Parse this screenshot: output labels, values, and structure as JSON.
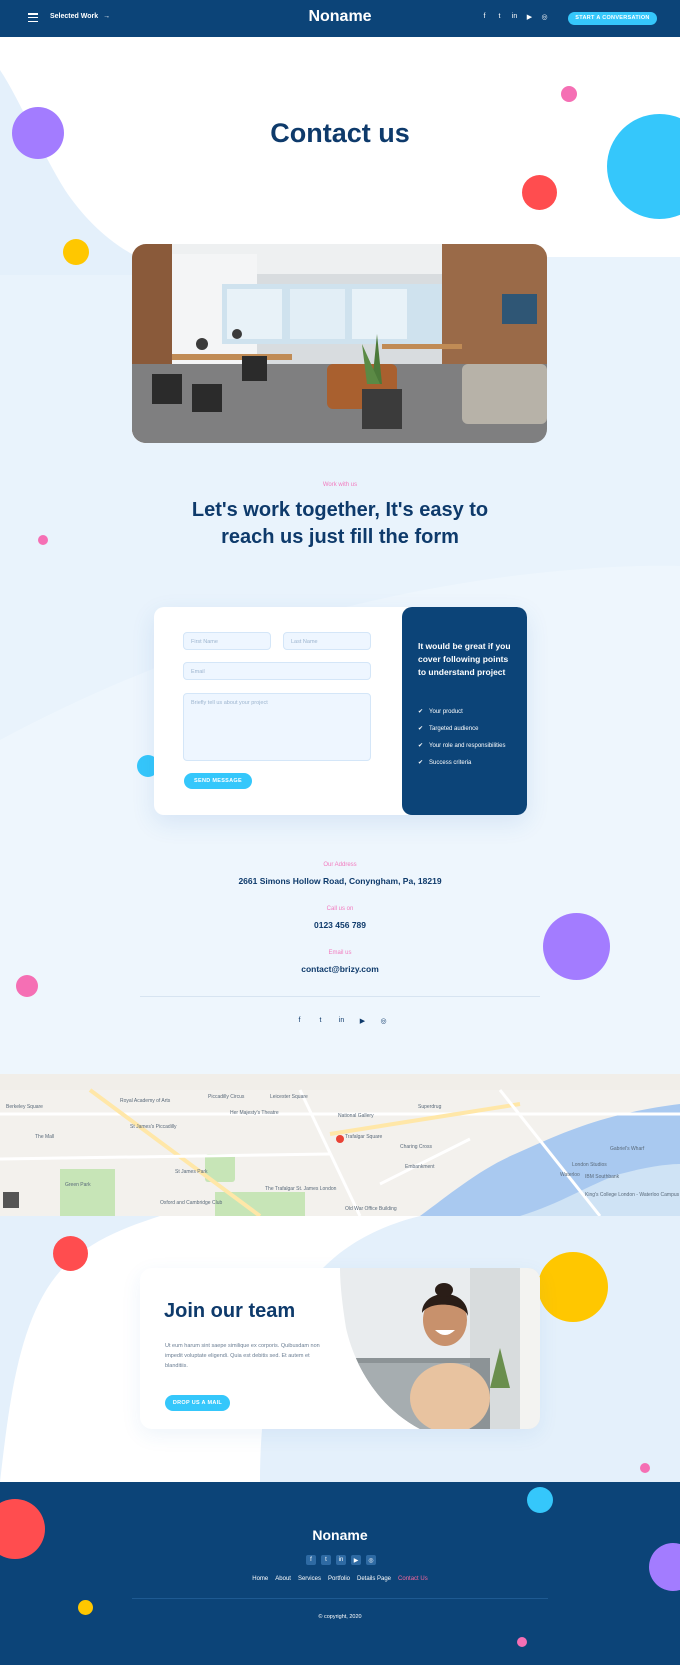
{
  "header": {
    "menu_icon": "hamburger-icon",
    "selected_work": "Selected Work",
    "arrow": "→",
    "brand": "Noname",
    "social": [
      "f",
      "t",
      "in",
      "▶",
      "◎"
    ],
    "cta": "START A CONVERSATION"
  },
  "hero": {
    "title": "Contact us",
    "image_alt": "open office"
  },
  "work": {
    "eyebrow": "Work with us",
    "title": "Let's work together, It's easy to reach us just fill the form"
  },
  "form": {
    "first_name_placeholder": "First Name",
    "last_name_placeholder": "Last Name",
    "email_placeholder": "Email",
    "message_placeholder": "Briefly tell us about your project",
    "send_label": "SEND MESSAGE",
    "side_title": "It would be great if you cover following points to understand project",
    "points": [
      "Your product",
      "Targeted audience",
      "Your role and responsibilities",
      "Success criteria"
    ]
  },
  "contact": {
    "address_label": "Our Address",
    "address": "2661  Simons Hollow Road, Conyngham, Pa, 18219",
    "phone_label": "Call us on",
    "phone": "0123 456 789",
    "email_label": "Email us",
    "email": "contact@brizy.com",
    "social": [
      "f",
      "t",
      "in",
      "▶",
      "◎"
    ]
  },
  "map": {
    "labels": [
      "Royal Academy of Arts",
      "Berkeley Square",
      "Piccadilly Circus",
      "Leicester Square",
      "St James's Piccadilly",
      "The Mall",
      "National Gallery",
      "Trafalgar Square",
      "The Trafalgar St. James London",
      "Embankment",
      "Charing Cross",
      "Waterloo",
      "King's College London - Waterloo Campus",
      "Green Park",
      "Oxford and Cambridge Club",
      "Old War Office Building",
      "Gabriel's Wharf",
      "IBM Southbank",
      "Superdrug",
      "London Studios",
      "Her Majesty's Theatre",
      "St James Park"
    ]
  },
  "join": {
    "title": "Join our team",
    "text": "Ut eum harum sint saepe similique ex corporis. Quibusdam non impedit voluptate eligendi. Quia est debitis sed. Et autem et blanditiis.",
    "button": "DROP US A MAIL"
  },
  "footer": {
    "brand": "Noname",
    "social": [
      "f",
      "t",
      "in",
      "▶",
      "◎"
    ],
    "nav": [
      "Home",
      "About",
      "Services",
      "Portfolio",
      "Details Page",
      "Contact Us"
    ],
    "copyright": "© copyright, 2020"
  },
  "colors": {
    "navy": "#0c4478",
    "cyan": "#35c7fb",
    "purple": "#a37cff",
    "red": "#ff4d4f",
    "yellow": "#ffc700",
    "pink": "#f56fb4"
  }
}
